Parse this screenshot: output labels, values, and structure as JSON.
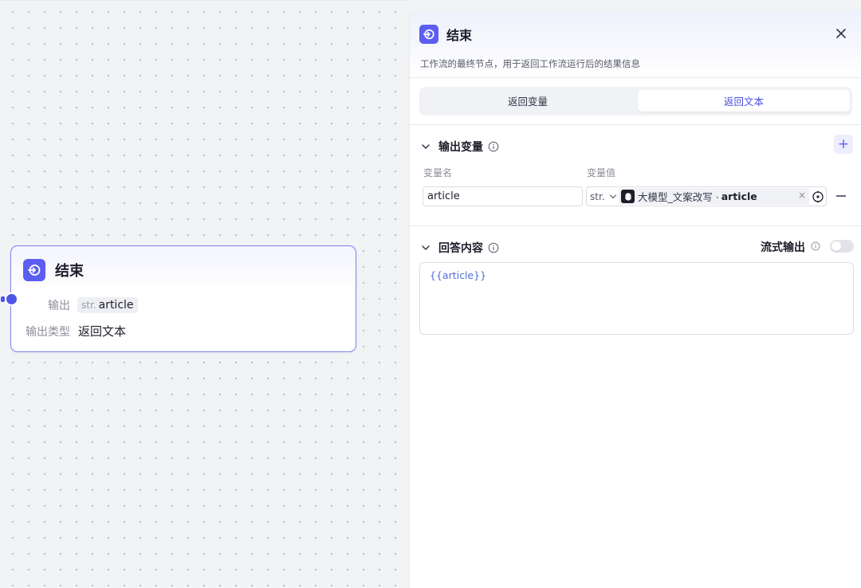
{
  "canvas": {
    "node": {
      "icon": "end-node-icon",
      "title": "结束",
      "output_label": "输出",
      "output_type": "str.",
      "output_value": "article",
      "output_type_label": "输出类型",
      "output_type_value": "返回文本"
    }
  },
  "panel": {
    "icon": "end-node-icon",
    "title": "结束",
    "description": "工作流的最终节点，用于返回工作流运行后的结果信息",
    "close_icon": "close-icon",
    "tabs": [
      {
        "label": "返回变量",
        "active": false
      },
      {
        "label": "返回文本",
        "active": true
      }
    ],
    "output_section": {
      "title": "输出变量",
      "col_name": "变量名",
      "col_value": "变量值",
      "add_label": "+",
      "row": {
        "name": "article",
        "type": "str.",
        "ref_source": "大模型_文案改写 · ",
        "ref_var": "article",
        "clear": "×"
      }
    },
    "answer_section": {
      "title": "回答内容",
      "stream_label": "流式输出",
      "stream_enabled": false,
      "content": "{{article}}"
    }
  },
  "colors": {
    "accent": "#5b5ef0",
    "node_border": "#7f82f0",
    "port": "#4e55e6",
    "template_text": "#4e6fd8"
  }
}
